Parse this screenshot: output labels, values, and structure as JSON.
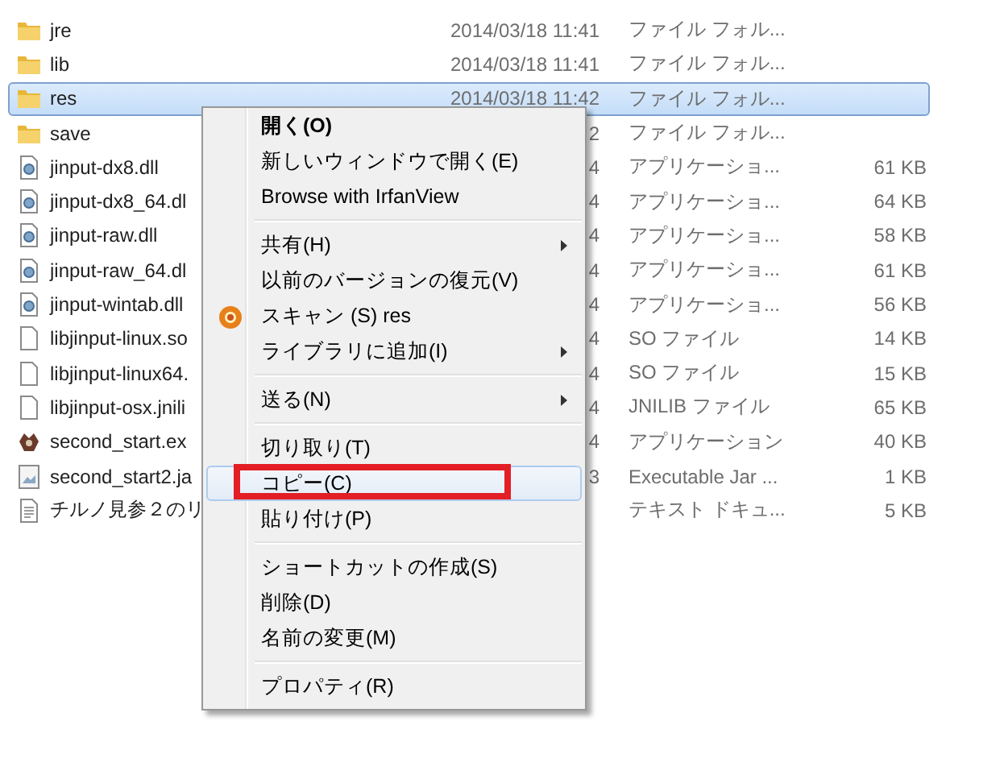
{
  "files": [
    {
      "kind": "folder",
      "name": "jre",
      "date": "2014/03/18 11:41",
      "type": "ファイル フォル...",
      "selected": false
    },
    {
      "kind": "folder",
      "name": "lib",
      "date": "2014/03/18 11:41",
      "type": "ファイル フォル...",
      "selected": false
    },
    {
      "kind": "folder",
      "name": "res",
      "date": "2014/03/18 11:42",
      "type": "ファイル フォル...",
      "selected": true
    },
    {
      "kind": "folder",
      "name": "save",
      "date": "2",
      "type": "ファイル フォル...",
      "selected": false
    },
    {
      "kind": "dll",
      "name": "jinput-dx8.dll",
      "date": "4",
      "type": "アプリケーショ...",
      "size": "61 KB",
      "selected": false
    },
    {
      "kind": "dll",
      "name": "jinput-dx8_64.dl",
      "date": "4",
      "type": "アプリケーショ...",
      "size": "64 KB",
      "selected": false
    },
    {
      "kind": "dll",
      "name": "jinput-raw.dll",
      "date": "4",
      "type": "アプリケーショ...",
      "size": "58 KB",
      "selected": false
    },
    {
      "kind": "dll",
      "name": "jinput-raw_64.dl",
      "date": "4",
      "type": "アプリケーショ...",
      "size": "61 KB",
      "selected": false
    },
    {
      "kind": "dll",
      "name": "jinput-wintab.dll",
      "date": "4",
      "type": "アプリケーショ...",
      "size": "56 KB",
      "selected": false
    },
    {
      "kind": "file",
      "name": "libjinput-linux.so",
      "date": "4",
      "type": "SO ファイル",
      "size": "14 KB",
      "selected": false
    },
    {
      "kind": "file",
      "name": "libjinput-linux64.",
      "date": "4",
      "type": "SO ファイル",
      "size": "15 KB",
      "selected": false
    },
    {
      "kind": "file",
      "name": "libjinput-osx.jnili",
      "date": "4",
      "type": "JNILIB ファイル",
      "size": "65 KB",
      "selected": false
    },
    {
      "kind": "exe",
      "name": "second_start.ex",
      "date": "4",
      "type": "アプリケーション",
      "size": "40 KB",
      "selected": false
    },
    {
      "kind": "jar",
      "name": "second_start2.ja",
      "date": "3",
      "type": "Executable Jar ...",
      "size": "1 KB",
      "selected": false
    },
    {
      "kind": "text",
      "name": "チルノ見参２のリ",
      "type": "テキスト ドキュ...",
      "size": "5 KB",
      "selected": false
    }
  ],
  "context_menu": [
    {
      "kind": "item",
      "label": "開く(O)",
      "default": true,
      "selected": false
    },
    {
      "kind": "item",
      "label": "新しいウィンドウで開く(E)",
      "selected": false
    },
    {
      "kind": "item",
      "label": "Browse with IrfanView",
      "selected": false
    },
    {
      "kind": "separator"
    },
    {
      "kind": "item",
      "label": "共有(H)",
      "submenu": true,
      "selected": false
    },
    {
      "kind": "item",
      "label": "以前のバージョンの復元(V)",
      "selected": false
    },
    {
      "kind": "item",
      "label": "スキャン (S) res",
      "icon": true,
      "selected": false
    },
    {
      "kind": "item",
      "label": "ライブラリに追加(I)",
      "submenu": true,
      "selected": false
    },
    {
      "kind": "separator"
    },
    {
      "kind": "item",
      "label": "送る(N)",
      "submenu": true,
      "selected": false
    },
    {
      "kind": "separator"
    },
    {
      "kind": "item",
      "label": "切り取り(T)",
      "selected": false
    },
    {
      "kind": "item",
      "label": "コピー(C)",
      "selected": true,
      "marked": true
    },
    {
      "kind": "item",
      "label": "貼り付け(P)",
      "selected": false
    },
    {
      "kind": "separator"
    },
    {
      "kind": "item",
      "label": "ショートカットの作成(S)",
      "selected": false
    },
    {
      "kind": "item",
      "label": "削除(D)",
      "selected": false
    },
    {
      "kind": "item",
      "label": "名前の変更(M)",
      "selected": false
    },
    {
      "kind": "separator"
    },
    {
      "kind": "item",
      "label": "プロパティ(R)",
      "selected": false
    }
  ]
}
